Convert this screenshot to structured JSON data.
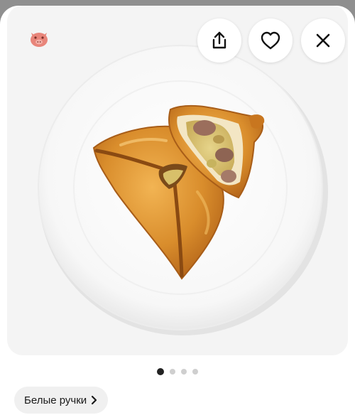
{
  "product": {
    "image_alt_icon": "pie-on-plate-image",
    "gallery": {
      "total": 4,
      "active_index": 0
    }
  },
  "header_actions": {
    "badge_icon": "pig-icon",
    "share_icon": "share-icon",
    "favorite_icon": "heart-icon",
    "close_icon": "close-icon"
  },
  "store_chip": {
    "label": "Белые ручки",
    "icon": "chevron-right-icon"
  },
  "colors": {
    "badge": "#e8857a",
    "active_dot": "#222222",
    "inactive_dot": "#cfcfcf",
    "chip_bg": "#f0f0f0"
  }
}
